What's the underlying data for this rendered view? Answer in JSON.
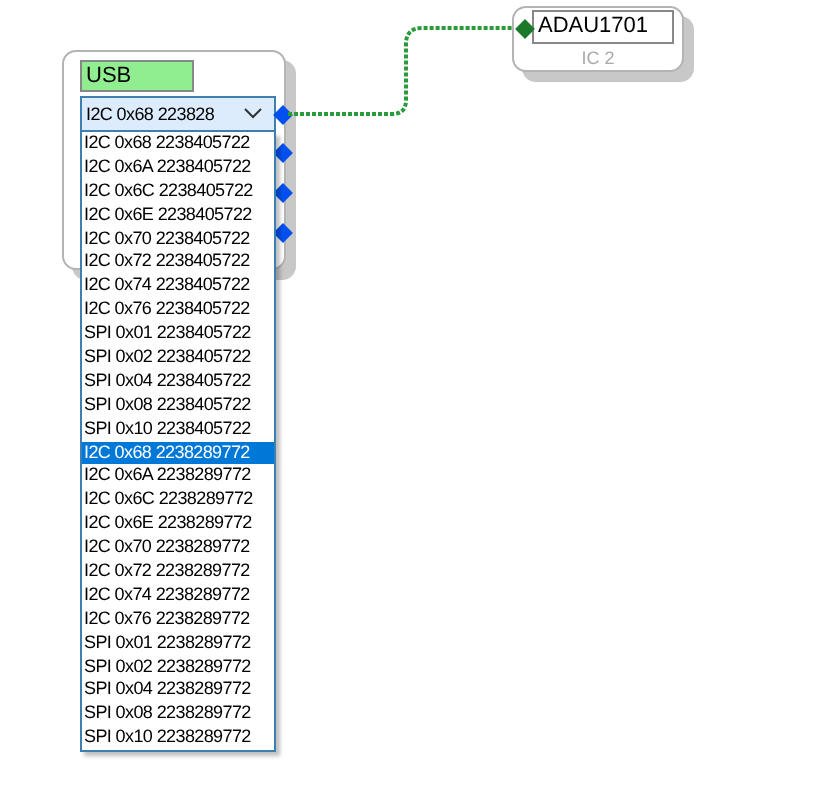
{
  "usb_block": {
    "name": "USB",
    "selector": {
      "value": "I2C 0x68 223828",
      "expanded": true,
      "options": [
        {
          "label": "I2C 0x68 2238405722",
          "selected": false
        },
        {
          "label": "I2C 0x6A 2238405722",
          "selected": false
        },
        {
          "label": "I2C 0x6C 2238405722",
          "selected": false
        },
        {
          "label": "I2C 0x6E 2238405722",
          "selected": false
        },
        {
          "label": "I2C 0x70 2238405722",
          "selected": false
        },
        {
          "label": "I2C 0x72 2238405722",
          "selected": false
        },
        {
          "label": "I2C 0x74 2238405722",
          "selected": false
        },
        {
          "label": "I2C 0x76 2238405722",
          "selected": false
        },
        {
          "label": "SPI 0x01 2238405722",
          "selected": false
        },
        {
          "label": "SPI 0x02 2238405722",
          "selected": false
        },
        {
          "label": "SPI 0x04 2238405722",
          "selected": false
        },
        {
          "label": "SPI 0x08 2238405722",
          "selected": false
        },
        {
          "label": "SPI 0x10 2238405722",
          "selected": false
        },
        {
          "label": "I2C 0x68 2238289772",
          "selected": true
        },
        {
          "label": "I2C 0x6A 2238289772",
          "selected": false
        },
        {
          "label": "I2C 0x6C 2238289772",
          "selected": false
        },
        {
          "label": "I2C 0x6E 2238289772",
          "selected": false
        },
        {
          "label": "I2C 0x70 2238289772",
          "selected": false
        },
        {
          "label": "I2C 0x72 2238289772",
          "selected": false
        },
        {
          "label": "I2C 0x74 2238289772",
          "selected": false
        },
        {
          "label": "I2C 0x76 2238289772",
          "selected": false
        },
        {
          "label": "SPI 0x01 2238289772",
          "selected": false
        },
        {
          "label": "SPI 0x02 2238289772",
          "selected": false
        },
        {
          "label": "SPI 0x04 2238289772",
          "selected": false
        },
        {
          "label": "SPI 0x08 2238289772",
          "selected": false
        },
        {
          "label": "SPI 0x10 2238289772",
          "selected": false
        }
      ]
    }
  },
  "ic_block": {
    "name": "ADAU1701",
    "label": "IC 2"
  }
}
